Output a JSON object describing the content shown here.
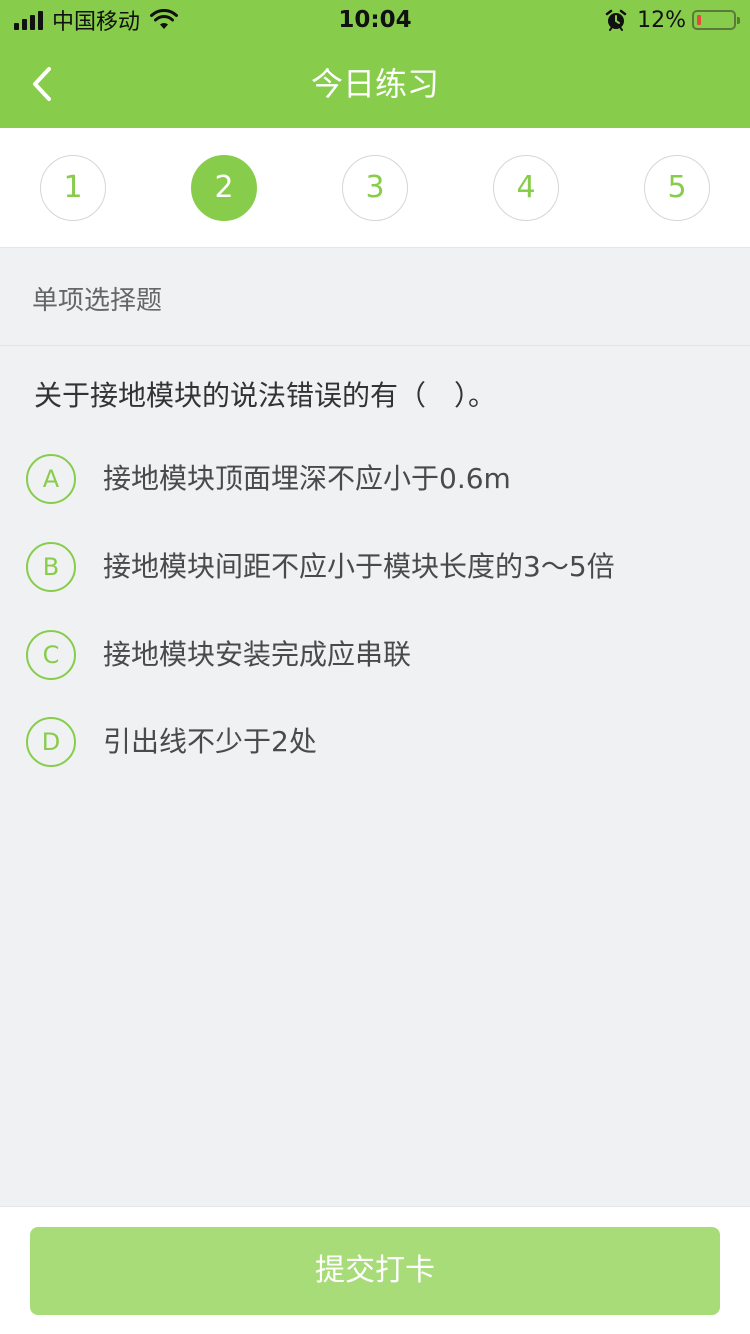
{
  "status_bar": {
    "carrier": "中国移动",
    "time": "10:04",
    "battery_percent": "12%",
    "battery_level": 0.12,
    "icons": [
      "signal-icon",
      "wifi-icon",
      "alarm-icon",
      "battery-icon"
    ]
  },
  "nav": {
    "title": "今日练习",
    "back_icon": "chevron-left-icon"
  },
  "question_numbers": {
    "items": [
      "1",
      "2",
      "3",
      "4",
      "5"
    ],
    "active": "2"
  },
  "question": {
    "type": "单项选择题",
    "text": "关于接地模块的说法错误的有（　）。",
    "options": [
      {
        "letter": "A",
        "text": "接地模块顶面埋深不应小于0.6m"
      },
      {
        "letter": "B",
        "text": "接地模块间距不应小于模块长度的3～5倍"
      },
      {
        "letter": "C",
        "text": "接地模块安装完成应串联"
      },
      {
        "letter": "D",
        "text": "引出线不少于2处"
      }
    ]
  },
  "footer": {
    "submit_label": "提交打卡"
  },
  "colors": {
    "accent": "#87cd4b",
    "button_disabled": "#a8dc78",
    "background": "#f0f1f3"
  }
}
